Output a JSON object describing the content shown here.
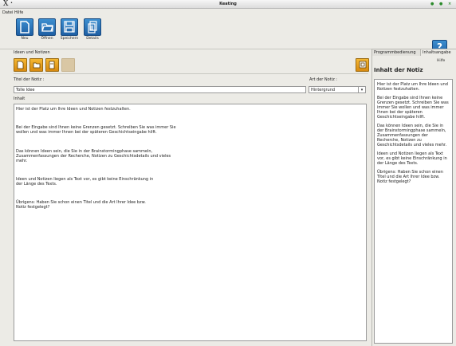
{
  "window": {
    "title": "Keating",
    "x_glyph": "X",
    "dot": "•",
    "controls": [
      "●",
      "●",
      "×"
    ]
  },
  "menu": [
    "Datei",
    "Hilfe"
  ],
  "toolbar": {
    "buttons": [
      {
        "label": "Neu",
        "icon": "new-document-icon"
      },
      {
        "label": "Öffnen",
        "icon": "open-folder-icon"
      },
      {
        "label": "Speichern",
        "icon": "save-disk-icon"
      },
      {
        "label": "Details",
        "icon": "details-document-icon"
      }
    ],
    "help_label": "Hilfe",
    "help_glyph": "?"
  },
  "left": {
    "panel_title": "Ideen und Notizen",
    "note_title_label": "Titel der Notiz :",
    "note_title_value": "Tolle Idee",
    "note_type_label": "Art der Notiz :",
    "note_type_value": "Hintergrund",
    "content_label": "Inhalt",
    "content": [
      "Hier ist der Platz um Ihre Ideen und Notizen festzuhalten.",
      "Bei der Eingabe sind Ihnen keine Grenzen gesetzt. Schreiben Sie was immer Sie wollen und was immer Ihnen bei der späteren Geschichtseingabe hilft.",
      "Das können Ideen sein, die Sie in der Brainstormingphase sammeln, Zusammenfassungen der Recherche, Notizen zu Geschichtsdetails und vieles mehr.",
      "Ideen und Notizen liegen als Text vor, es gibt keine Einschränkung in der Länge des Texts.",
      "Übrigens: Haben Sie schon einen Titel und die Art Ihrer Idee bzw. Notiz festgelegt?"
    ]
  },
  "right": {
    "tabs": [
      "Programmbedienung",
      "Inhaltsangabe"
    ],
    "title": "Inhalt der Notiz",
    "paragraphs": [
      "Hier ist der Platz um Ihre Ideen und Notizen festzuhalten.",
      "Bei der Eingabe sind Ihnen keine Grenzen gesetzt. Schreiben Sie was immer Sie wollen und was immer Ihnen bei der späteren Geschichtseingabe hilft.",
      "Das können Ideen sein, die Sie in der Brainstormingphase sammeln, Zusammenfassungen der Recherche, Notizen zu Geschichtsdetails und vieles mehr.",
      "Ideen und Notizen liegen als Text vor, es gibt keine Einschränkung in der Länge des Texts.",
      "Übrigens: Haben Sie schon einen Titel und die Art Ihrer Idee bzw. Notiz festgelegt?"
    ]
  },
  "colors": {
    "accent_blue": "#1e5fa4",
    "accent_orange": "#e09a1e",
    "status_green": "#2b8a2b"
  }
}
